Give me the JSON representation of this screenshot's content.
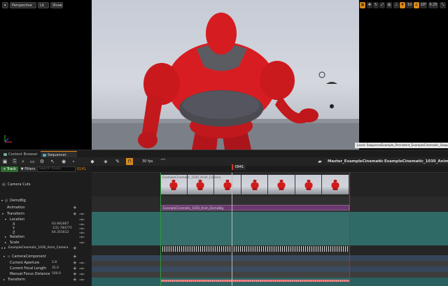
{
  "viewport": {
    "perspective_label": "Perspective",
    "lit_label": "Lit",
    "show_label": "Show",
    "speed_value": "0.25",
    "grid_value": "10",
    "angle_value": "10°",
    "level_label": "Level: SequenceExample_Persistent_ExampleCinematic_Sequencer"
  },
  "tabs": [
    {
      "label": "Content Browser"
    },
    {
      "label": "Sequencer"
    }
  ],
  "toolbar": {
    "fps_label": "30 fps",
    "breadcrumb_root": "Master_ExampleCinematic",
    "breadcrumb_child": "ExampleCinematic_1030_Anim"
  },
  "track_header": {
    "add_track_label": "+ Track",
    "filters_label": "Filters",
    "search_placeholder": "Search Tracks",
    "current_frame": "0141"
  },
  "playhead_frame": "0941",
  "tracks": [
    {
      "label": "Camera Cuts"
    },
    {
      "label": "DemoBig"
    },
    {
      "label": "Animation"
    },
    {
      "label": "Transform"
    },
    {
      "label": "Location"
    },
    {
      "label": "X",
      "value": "63.981807"
    },
    {
      "label": "Y",
      "value": "-231.784775"
    },
    {
      "label": "Z",
      "value": "64.355612"
    },
    {
      "label": "Rotation"
    },
    {
      "label": "Scale"
    },
    {
      "label": "ExampleCinematic_1030_Anim_Camera"
    },
    {
      "label": "CameraComponent"
    },
    {
      "label": "Current Aperture",
      "value": "2.8"
    },
    {
      "label": "Current Focal Length",
      "value": "35.0"
    },
    {
      "label": "Manual Focus Distance",
      "value": "500.0"
    },
    {
      "label": "Transform"
    }
  ],
  "timeline": {
    "camera_cut_label": "ExampleCinematic_1030_Anim_Camera",
    "animation_clip_label": "ExampleCinematic_1030_Anim_DemoBig"
  },
  "colors": {
    "accent": "#e08a1b",
    "playhead": "#d23b2b",
    "animation_bar": "#6a3a6e",
    "transform_bg": "#2f6a66",
    "camera_bg": "#35465a"
  }
}
